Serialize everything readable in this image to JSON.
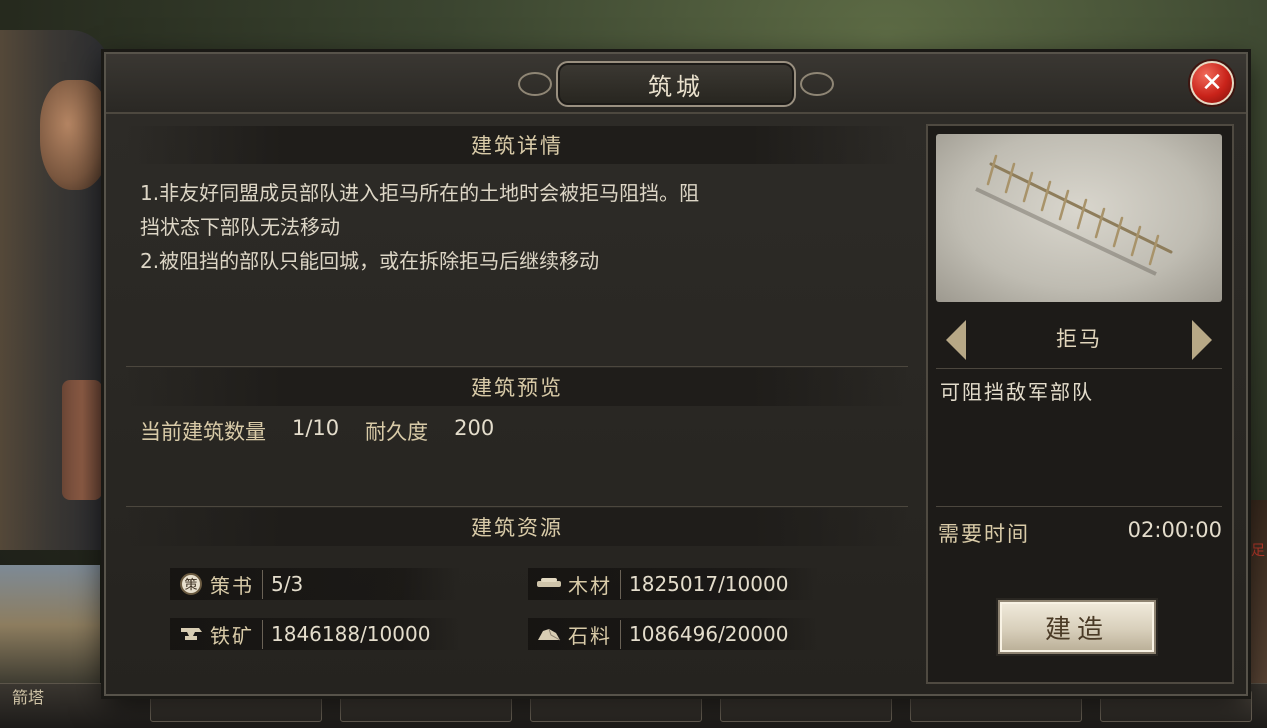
{
  "background": {
    "bottom_label": "箭塔",
    "right_hint": "足"
  },
  "dialog": {
    "title": "筑城",
    "close_icon": "close-x-icon"
  },
  "details": {
    "header": "建筑详情",
    "lines": [
      "1.非友好同盟成员部队进入拒马所在的土地时会被拒马阻挡。阻",
      "挡状态下部队无法移动",
      "2.被阻挡的部队只能回城，或在拆除拒马后继续移动"
    ]
  },
  "preview": {
    "header": "建筑预览",
    "count_label": "当前建筑数量",
    "count_value": "1/10",
    "durability_label": "耐久度",
    "durability_value": "200"
  },
  "resources": {
    "header": "建筑资源",
    "items": [
      {
        "icon": "strategy-book-icon",
        "name": "策书",
        "value": "5/3"
      },
      {
        "icon": "wood-icon",
        "name": "木材",
        "value": "1825017/10000"
      },
      {
        "icon": "iron-anvil-icon",
        "name": "铁矿",
        "value": "1846188/10000"
      },
      {
        "icon": "stone-icon",
        "name": "石料",
        "value": "1086496/20000"
      }
    ]
  },
  "building": {
    "name": "拒马",
    "description": "可阻挡敌军部队",
    "time_label": "需要时间",
    "time_value": "02:00:00",
    "build_button": "建造",
    "book_glyph": "策"
  }
}
